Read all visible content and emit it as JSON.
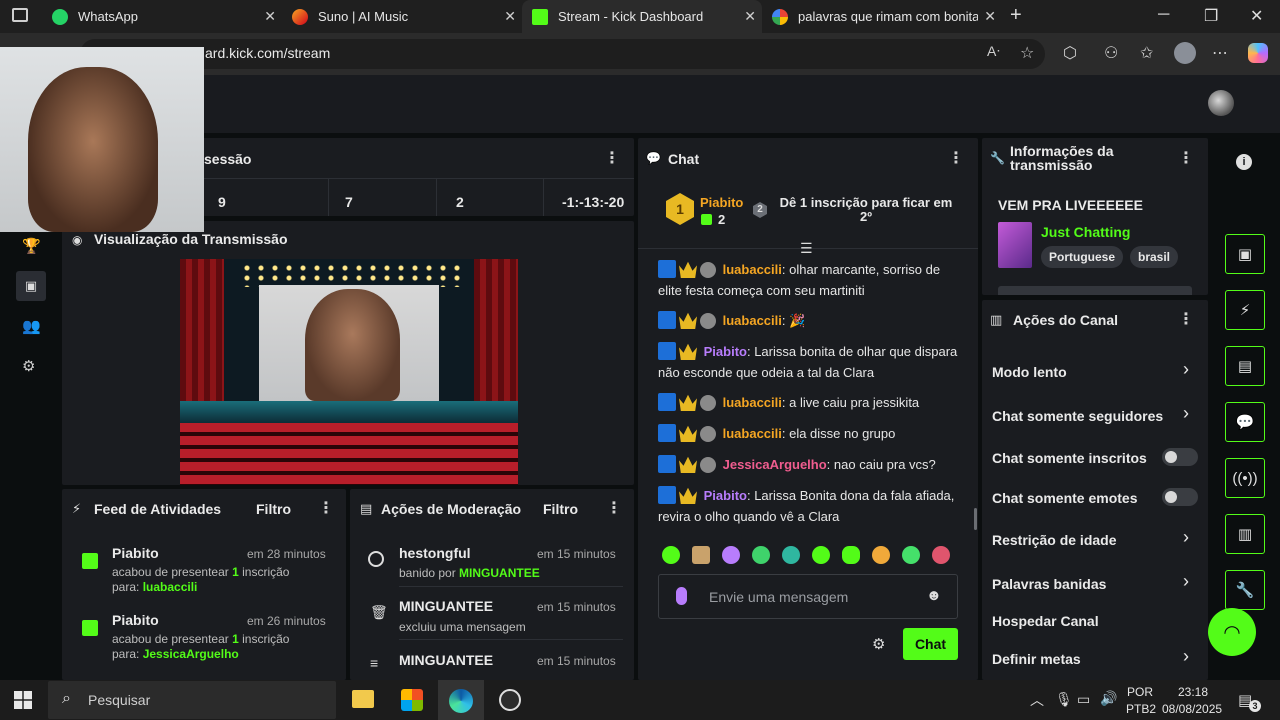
{
  "browser": {
    "tabs": [
      {
        "title": "WhatsApp"
      },
      {
        "title": "Suno | AI Music"
      },
      {
        "title": "Stream - Kick Dashboard"
      },
      {
        "title": "palavras que rimam com bonita -"
      }
    ],
    "url": "ard.kick.com/stream"
  },
  "session": {
    "title": "sessão",
    "stats": [
      "9",
      "7",
      "2",
      "-1:-13:-20"
    ]
  },
  "preview": {
    "title": "Visualização da Transmissão"
  },
  "feed": {
    "title": "Feed de Atividades",
    "filter": "Filtro",
    "items": [
      {
        "user": "Piabito",
        "time": "em 28 minutos",
        "text_a": "acabou de presentear ",
        "count": "1",
        "text_b": " inscrição",
        "para": "para: ",
        "target": "luabaccili"
      },
      {
        "user": "Piabito",
        "time": "em 26 minutos",
        "text_a": "acabou de presentear ",
        "count": "1",
        "text_b": " inscrição",
        "para": "para: ",
        "target": "JessicaArguelho"
      }
    ]
  },
  "moderation": {
    "title": "Ações de Moderação",
    "filter": "Filtro",
    "items": [
      {
        "user": "hestongful",
        "time": "em 15 minutos",
        "text": "banido por ",
        "by": "MINGUANTEE"
      },
      {
        "user": "MINGUANTEE",
        "time": "em 15 minutos",
        "text": "excluiu uma mensagem",
        "by": ""
      },
      {
        "user": "MINGUANTEE",
        "time": "em 15 minutos",
        "text": "",
        "by": ""
      }
    ]
  },
  "chat": {
    "title": "Chat",
    "top_gifter": {
      "rank": "1",
      "name": "Piabito",
      "count": "2"
    },
    "goal": {
      "rank": "2",
      "text": "Dê 1 inscrição para ficar em 2º"
    },
    "messages": [
      {
        "user": "luabaccili",
        "color": "orange",
        "text": ": olhar marcante, sorriso de elite festa começa com seu martiniti"
      },
      {
        "user": "luabaccili",
        "color": "orange",
        "text": ": 🎉"
      },
      {
        "user": "Piabito",
        "color": "purple",
        "text": ": Larissa bonita de olhar que dispara não esconde que odeia a tal da Clara"
      },
      {
        "user": "luabaccili",
        "color": "orange",
        "text": ": a live caiu pra jessikita"
      },
      {
        "user": "luabaccili",
        "color": "orange",
        "text": ": ela disse no grupo"
      },
      {
        "user": "JessicaArguelho",
        "color": "pink",
        "text": ": nao caiu pra vcs?"
      },
      {
        "user": "Piabito",
        "color": "purple",
        "text": ": Larissa Bonita dona da fala afiada, revira o olho quando vê a Clara"
      }
    ],
    "input_placeholder": "Envie uma mensagem",
    "send_label": "Chat"
  },
  "info": {
    "title": "Informações da transmissão",
    "stream_title": "VEM PRA LIVEEEEEE",
    "category": "Just Chatting",
    "tags": [
      "Portuguese",
      "brasil"
    ]
  },
  "actions": {
    "title": "Ações do Canal",
    "rows": [
      {
        "label": "Modo lento",
        "kind": "chevron"
      },
      {
        "label": "Chat somente seguidores",
        "kind": "chevron"
      },
      {
        "label": "Chat somente inscritos",
        "kind": "toggle"
      },
      {
        "label": "Chat somente emotes",
        "kind": "toggle"
      },
      {
        "label": "Restrição de idade",
        "kind": "chevron"
      },
      {
        "label": "Palavras banidas",
        "kind": "chevron"
      },
      {
        "label": "Hospedar Canal",
        "kind": "none"
      },
      {
        "label": "Definir metas",
        "kind": "chevron"
      }
    ]
  },
  "taskbar": {
    "search_placeholder": "Pesquisar",
    "lang": "POR",
    "layout": "PTB2",
    "time": "23:18",
    "date": "08/08/2025",
    "notif_count": "3"
  },
  "colors": {
    "kick_green": "#53fc18",
    "panel": "#1a1c20",
    "bg": "#0b0e0f"
  }
}
